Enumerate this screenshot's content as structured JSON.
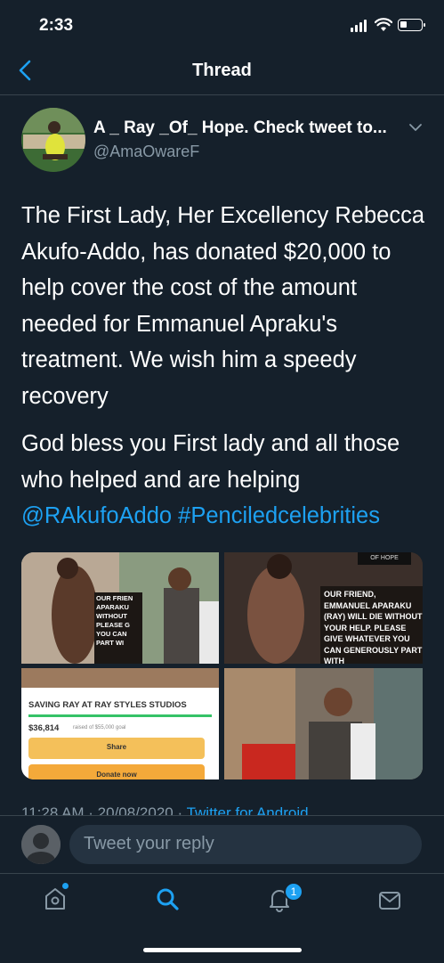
{
  "status_bar": {
    "time": "2:33"
  },
  "header": {
    "title": "Thread",
    "back_icon": "chevron-left-icon"
  },
  "author": {
    "display_name": "A _ Ray _Of_ Hope. Check tweet to...",
    "handle": "@AmaOwareF"
  },
  "tweet": {
    "paragraph1": "The First Lady, Her Excellency Rebecca Akufo-Addo, has donated $20,000 to help cover the cost of the amount needed for Emmanuel Apraku's treatment. We wish him a speedy recovery",
    "paragraph2_text": "God bless you First lady and all those who helped and are helping ",
    "mention": "@RAkufoAddo",
    "hashtag": "#Penciledcelebrities",
    "timestamp": "11:28 AM · 20/08/2020 · ",
    "source": "Twitter for Android"
  },
  "media": {
    "tile1_caption": "OUR FRIEN APARAKU WITHOUT PLEASE G YOU CAN PART WI",
    "tile2_brand": "OF HOPE",
    "tile2_caption": "OUR FRIEND, EMMANUEL APARAKU (RAY) WILL DIE WITHOUT YOUR HELP. PLEASE GIVE WHATEVER YOU CAN GENEROUSLY PART WITH",
    "tile3_title": "SAVING RAY AT RAY STYLES STUDIOS",
    "tile3_raised": "$36,814",
    "tile3_goal": "raised of $55,000 goal",
    "tile3_share": "Share",
    "tile3_donate": "Donate now"
  },
  "reply": {
    "placeholder": "Tweet your reply"
  },
  "tabbar": {
    "notifications_badge": "1",
    "icons": [
      "home-icon",
      "search-icon",
      "notifications-icon",
      "messages-icon"
    ]
  },
  "colors": {
    "background": "#15202b",
    "accent": "#1da1f2",
    "muted": "#8899a6",
    "divider": "#38444d"
  }
}
